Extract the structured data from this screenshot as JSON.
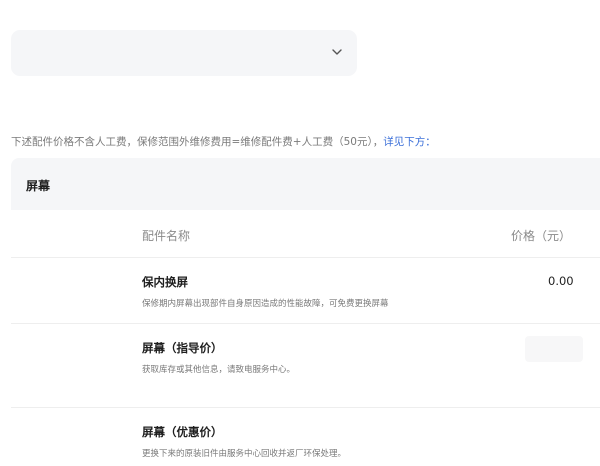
{
  "notice": {
    "text": "下述配件价格不含人工费，保修范围外维修费用=维修配件费+人工费（50元），",
    "link": "详见下方："
  },
  "category": {
    "title": "屏幕"
  },
  "columns": {
    "name": "配件名称",
    "price": "价格（元）"
  },
  "rows": [
    {
      "name": "保内换屏",
      "desc": "保修期内屏幕出现部件自身原因造成的性能故障，可免费更换屏幕",
      "price": "0.00"
    },
    {
      "name": "屏幕（指导价）",
      "desc": "获取库存或其他信息，请致电服务中心。",
      "price": ""
    },
    {
      "name": "屏幕（优惠价）",
      "desc": "更换下来的原装旧件由服务中心回收并返厂环保处理。",
      "price": ""
    }
  ],
  "icons": {
    "select_chevron": "chevron-down-icon"
  }
}
